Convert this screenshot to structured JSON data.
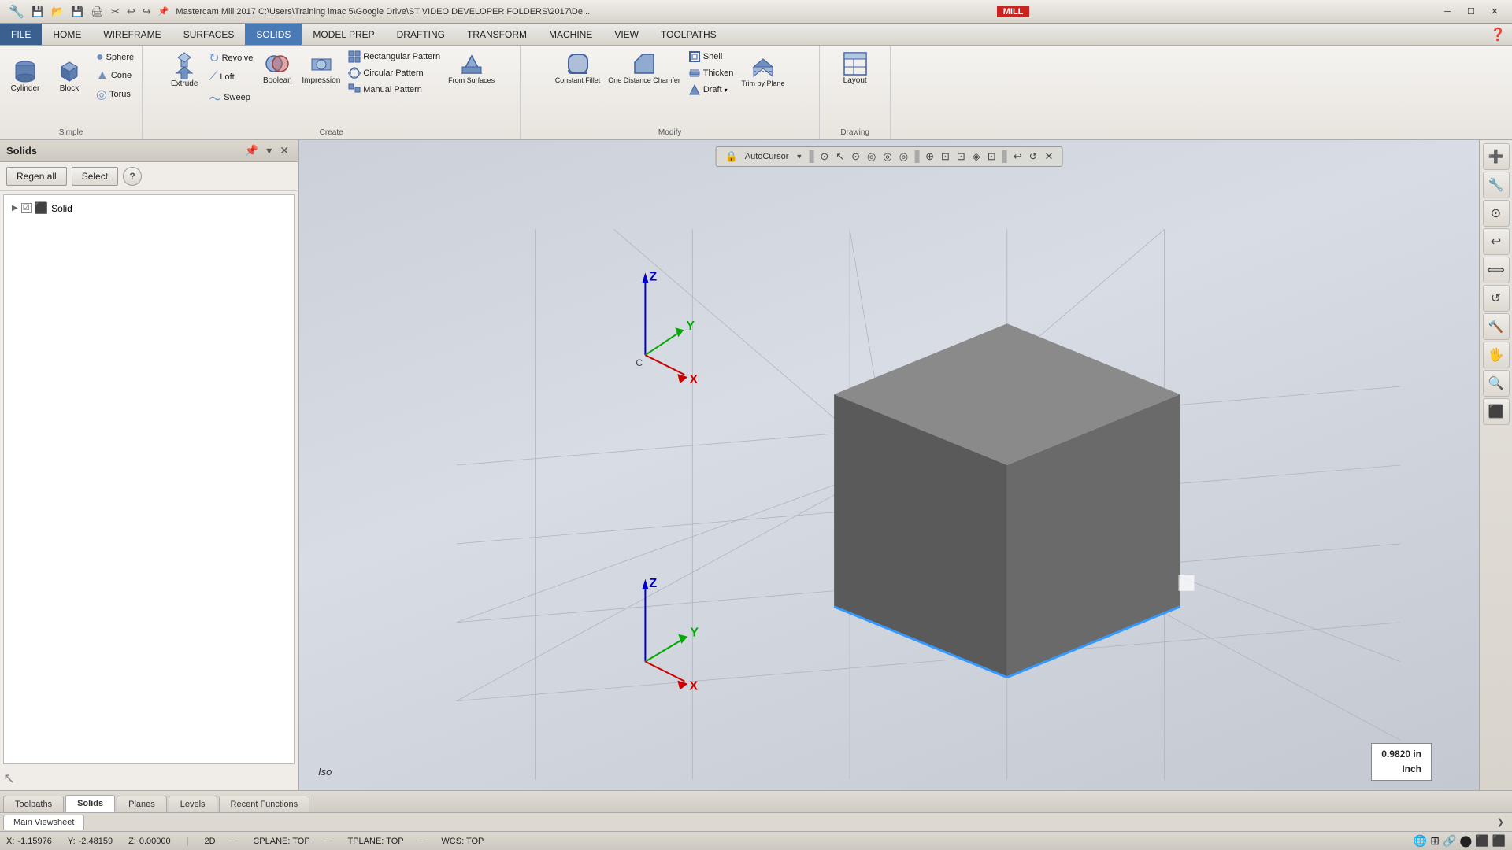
{
  "titlebar": {
    "title": "Mastercam Mill 2017  C:\\Users\\Training imac 5\\Google Drive\\ST VIDEO DEVELOPER FOLDERS\\2017\\De...",
    "app": "MILL",
    "controls": [
      "─",
      "☐",
      "✕"
    ]
  },
  "quickaccess": [
    "💾",
    "📁",
    "💾",
    "🖨",
    "✂",
    "📋",
    "↩",
    "↪"
  ],
  "menus": [
    {
      "label": "FILE",
      "active": false
    },
    {
      "label": "HOME",
      "active": false
    },
    {
      "label": "WIREFRAME",
      "active": false
    },
    {
      "label": "SURFACES",
      "active": false
    },
    {
      "label": "SOLIDS",
      "active": true
    },
    {
      "label": "MODEL PREP",
      "active": false
    },
    {
      "label": "DRAFTING",
      "active": false
    },
    {
      "label": "TRANSFORM",
      "active": false
    },
    {
      "label": "MACHINE",
      "active": false
    },
    {
      "label": "VIEW",
      "active": false
    },
    {
      "label": "TOOLPATHS",
      "active": false
    }
  ],
  "ribbon": {
    "groups": [
      {
        "label": "Simple",
        "buttons": [
          {
            "id": "cylinder",
            "label": "Cylinder",
            "icon": "⬤",
            "size": "large"
          },
          {
            "id": "block",
            "label": "Block",
            "icon": "⬛",
            "size": "large"
          },
          {
            "id": "sphere",
            "label": "Sphere",
            "icon": "●"
          },
          {
            "id": "cone",
            "label": "Cone",
            "icon": "▲"
          },
          {
            "id": "torus",
            "label": "Torus",
            "icon": "◎"
          }
        ]
      },
      {
        "label": "Create",
        "buttons": [
          {
            "id": "extrude",
            "label": "Extrude",
            "icon": "⬆",
            "size": "large"
          },
          {
            "id": "revolve",
            "label": "Revolve",
            "icon": "↻"
          },
          {
            "id": "loft",
            "label": "Loft",
            "icon": "⟋"
          },
          {
            "id": "sweep",
            "label": "Sweep",
            "icon": "〜"
          },
          {
            "id": "boolean",
            "label": "Boolean",
            "icon": "⊕",
            "size": "large"
          },
          {
            "id": "impression",
            "label": "Impression",
            "icon": "⊗",
            "size": "large"
          },
          {
            "id": "rect-pattern",
            "label": "Rectangular Pattern",
            "icon": "⊞"
          },
          {
            "id": "circ-pattern",
            "label": "Circular Pattern",
            "icon": "◈"
          },
          {
            "id": "manual-pattern",
            "label": "Manual Pattern",
            "icon": "⊟"
          },
          {
            "id": "from-surfaces",
            "label": "From Surfaces",
            "icon": "◧",
            "size": "large"
          }
        ]
      },
      {
        "label": "Modify",
        "buttons": [
          {
            "id": "const-fillet",
            "label": "Constant Fillet",
            "icon": "⌒",
            "size": "large"
          },
          {
            "id": "one-dist",
            "label": "One Distance Chamfer",
            "icon": "◤",
            "size": "large"
          },
          {
            "id": "shell",
            "label": "Shell",
            "icon": "□"
          },
          {
            "id": "thicken",
            "label": "Thicken",
            "icon": "≡"
          },
          {
            "id": "draft",
            "label": "Draft",
            "icon": "△"
          },
          {
            "id": "trim-plane",
            "label": "Trim by Plane",
            "icon": "✂",
            "size": "large"
          }
        ]
      },
      {
        "label": "Drawing",
        "buttons": [
          {
            "id": "layout",
            "label": "Layout",
            "icon": "⊞",
            "size": "large"
          }
        ]
      }
    ]
  },
  "panel": {
    "title": "Solids",
    "buttons": {
      "regen_all": "Regen all",
      "select": "Select",
      "help": "?"
    },
    "tree": [
      {
        "label": "Solid",
        "icon": "🔷",
        "expanded": false
      }
    ]
  },
  "viewport": {
    "toolbar_items": [
      "🔒",
      "AutoCursor",
      "▼",
      "⊙",
      "↖",
      "⊙",
      "◎",
      "◎",
      "◎",
      "⊕",
      "⊡",
      "⊡",
      "◈",
      "⊡",
      "↩",
      "↺",
      "✕"
    ],
    "iso_label": "Iso",
    "dim_value": "0.9820 in",
    "dim_unit": "Inch"
  },
  "bottom_tabs": [
    {
      "label": "Toolpaths",
      "active": false
    },
    {
      "label": "Solids",
      "active": true
    },
    {
      "label": "Planes",
      "active": false
    },
    {
      "label": "Levels",
      "active": false
    },
    {
      "label": "Recent Functions",
      "active": false
    }
  ],
  "viewsheet_tabs": [
    {
      "label": "Main Viewsheet",
      "active": true
    }
  ],
  "statusbar": {
    "x_label": "X:",
    "x_val": "-1.15976",
    "y_label": "Y:",
    "y_val": "-2.48159",
    "z_label": "Z:",
    "z_val": "0.00000",
    "mode": "2D",
    "cplane": "CPLANE: TOP",
    "tplane": "TPLANE: TOP",
    "wcs": "WCS: TOP"
  }
}
